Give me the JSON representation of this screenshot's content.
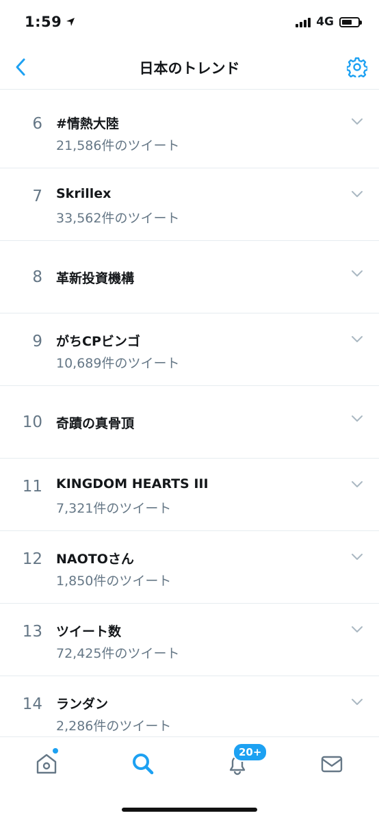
{
  "status_bar": {
    "time": "1:59",
    "network": "4G"
  },
  "header": {
    "title": "日本のトレンド"
  },
  "trends": [
    {
      "rank": "6",
      "name": "#情熱大陸",
      "tweets": "21,586件のツイート"
    },
    {
      "rank": "7",
      "name": "Skrillex",
      "tweets": "33,562件のツイート"
    },
    {
      "rank": "8",
      "name": "革新投資機構",
      "tweets": ""
    },
    {
      "rank": "9",
      "name": "がちCPビンゴ",
      "tweets": "10,689件のツイート"
    },
    {
      "rank": "10",
      "name": "奇蹟の真骨頂",
      "tweets": ""
    },
    {
      "rank": "11",
      "name": "KINGDOM HEARTS III",
      "tweets": "7,321件のツイート"
    },
    {
      "rank": "12",
      "name": "NAOTOさん",
      "tweets": "1,850件のツイート"
    },
    {
      "rank": "13",
      "name": "ツイート数",
      "tweets": "72,425件のツイート"
    },
    {
      "rank": "14",
      "name": "ランダン",
      "tweets": "2,286件のツイート"
    }
  ],
  "tab_bar": {
    "notifications_badge": "20+",
    "tabs": [
      "home-icon",
      "search-icon",
      "bell-icon",
      "mail-icon"
    ]
  },
  "colors": {
    "accent": "#1da1f2",
    "muted": "#657786",
    "text": "#14171a",
    "divider": "#e6ecf0"
  }
}
